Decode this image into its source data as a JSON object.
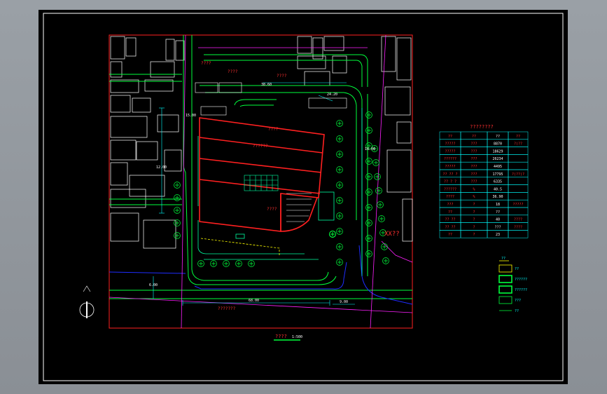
{
  "colors": {
    "background": "#000000",
    "frame": "#ffffff",
    "boundary": "#ff2020",
    "road": "#00ff3c",
    "landscape": "#00ffa0",
    "street_edge": "#1f2dff",
    "pipe": "#ff20ff",
    "dimension": "#00ffff",
    "label": "#ff3030",
    "highlight": "#ffff00"
  },
  "labels": {
    "plan_title": "????",
    "plan_scale": "1:500",
    "north_arrow_icon": "north-arrow-icon",
    "neighbor_label": "XX??",
    "road_label": "???????",
    "building_labels": [
      "????",
      "????",
      "????",
      "??????",
      "????",
      "????"
    ],
    "dims": [
      "38.60",
      "24.20",
      "12.00",
      "68.00",
      "9.00",
      "18.00",
      "15.00",
      "6.00"
    ]
  },
  "table": {
    "title": "????????",
    "header": [
      "??",
      "??",
      "??",
      "??"
    ],
    "rows": [
      [
        "?????",
        "???",
        "8870",
        "?(??"
      ],
      [
        "?????",
        "???",
        "18629",
        ""
      ],
      [
        "??????",
        "???",
        "26234",
        ""
      ],
      [
        "?????",
        "???",
        "4495",
        ""
      ],
      [
        "?? ?? ?",
        "???",
        "17795",
        "?(??)?"
      ],
      [
        "?? ? ?",
        "???",
        "6335",
        ""
      ],
      [
        "??????",
        "%",
        "40.5",
        ""
      ],
      [
        "????",
        "%",
        "36.90",
        ""
      ],
      [
        "???",
        "?",
        "18",
        "?????"
      ],
      [
        "??",
        "?",
        "??",
        ""
      ],
      [
        "?? ??",
        "?",
        "40",
        "????"
      ],
      [
        "?? ??",
        "?",
        "???",
        "????"
      ],
      [
        "??",
        "?",
        "23",
        ""
      ]
    ]
  },
  "legend": {
    "title": "??",
    "items": [
      {
        "label": "??"
      },
      {
        "label": "??????"
      },
      {
        "label": "??????"
      },
      {
        "label": "???"
      },
      {
        "label": "??"
      }
    ]
  }
}
